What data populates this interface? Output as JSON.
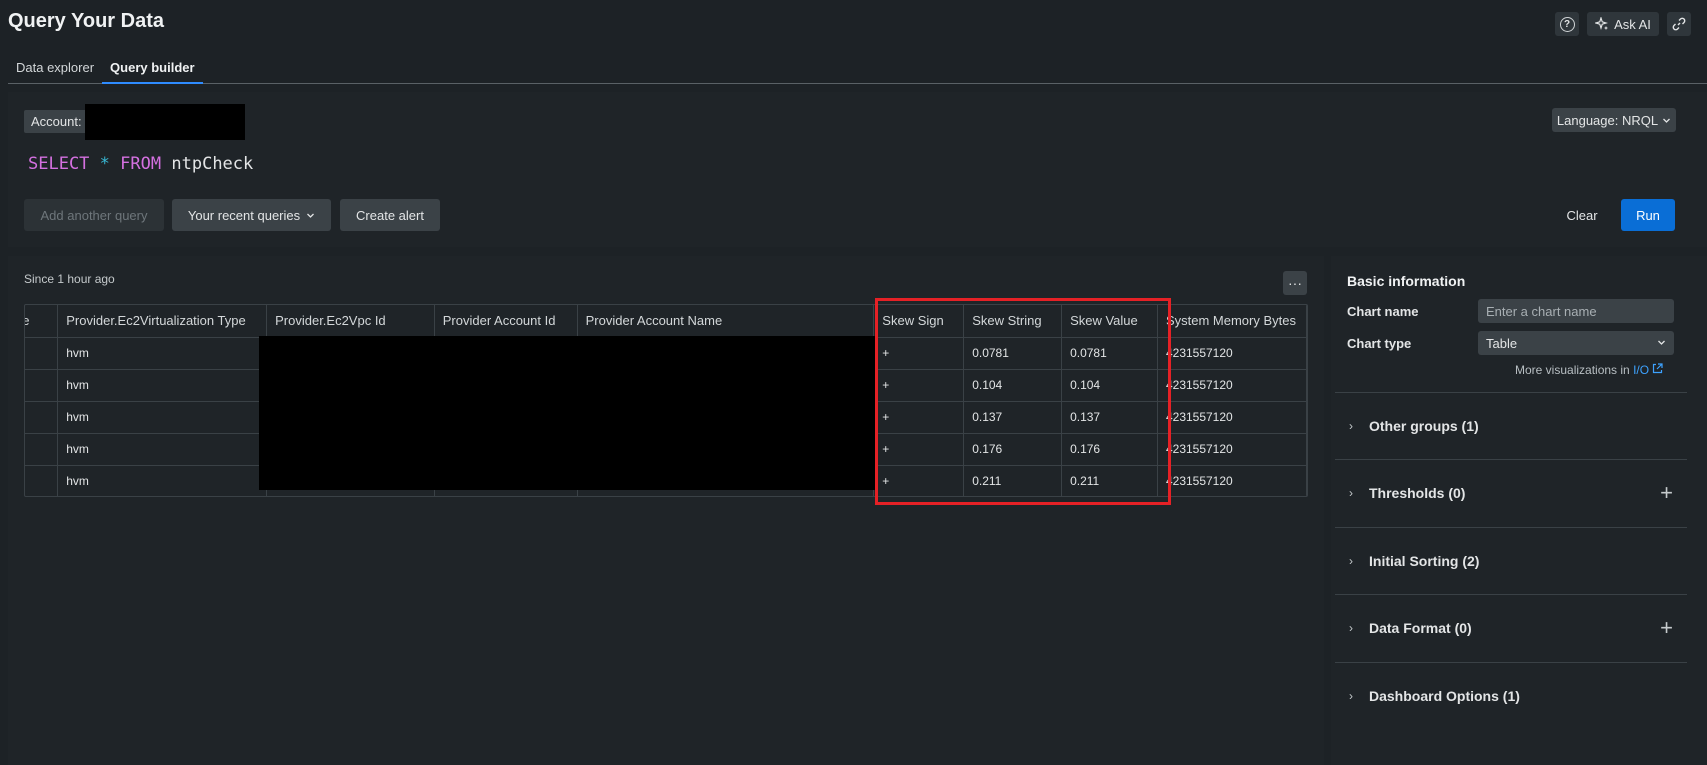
{
  "header": {
    "title": "Query Your Data",
    "help_icon_glyph": "?",
    "ask_ai_label": "Ask AI",
    "ask_ai_icon": "sparkle-icon",
    "link_icon": "link-icon"
  },
  "tabs": [
    {
      "label": "Data explorer",
      "active": false
    },
    {
      "label": "Query builder",
      "active": true
    }
  ],
  "editor": {
    "account_label": "Account:",
    "language_label": "Language: NRQL",
    "query": {
      "select": "SELECT",
      "star": "*",
      "from": "FROM",
      "table": "ntpCheck"
    },
    "add_query_label": "Add another query",
    "recent_label": "Your recent queries",
    "create_alert_label": "Create alert",
    "clear_label": "Clear",
    "run_label": "Run"
  },
  "results": {
    "since": "Since 1 hour ago",
    "more_glyph": "···",
    "columns": [
      "ne",
      "Provider.Ec2Virtualization Type",
      "Provider.Ec2Vpc Id",
      "Provider Account Id",
      "Provider Account Name",
      "Skew Sign",
      "Skew String",
      "Skew Value",
      "System Memory Bytes"
    ],
    "rows": [
      [
        "",
        "hvm",
        "",
        "",
        "",
        "+",
        "0.0781",
        "0.0781",
        "4231557120"
      ],
      [
        "",
        "hvm",
        "",
        "",
        "",
        "+",
        "0.104",
        "0.104",
        "4231557120"
      ],
      [
        "",
        "hvm",
        "",
        "",
        "",
        "+",
        "0.137",
        "0.137",
        "4231557120"
      ],
      [
        "",
        "hvm",
        "",
        "",
        "",
        "+",
        "0.176",
        "0.176",
        "4231557120"
      ],
      [
        "",
        "hvm",
        "",
        "",
        "",
        "+",
        "0.211",
        "0.211",
        "4231557120"
      ]
    ]
  },
  "config": {
    "basic_title": "Basic information",
    "chart_name_label": "Chart name",
    "chart_name_placeholder": "Enter a chart name",
    "chart_type_label": "Chart type",
    "chart_type_value": "Table",
    "more_viz_text": "More visualizations in",
    "more_viz_link": "I/O",
    "sections": [
      {
        "label": "Other groups (1)",
        "plus": false
      },
      {
        "label": "Thresholds (0)",
        "plus": true
      },
      {
        "label": "Initial Sorting (2)",
        "plus": false
      },
      {
        "label": "Data Format (0)",
        "plus": true
      },
      {
        "label": "Dashboard Options (1)",
        "plus": false
      }
    ]
  },
  "colors": {
    "accent_blue": "#0a6ed6",
    "highlight_red": "#e52126",
    "keyword_pink": "#d470e0",
    "operator_cyan": "#38b8d4"
  }
}
